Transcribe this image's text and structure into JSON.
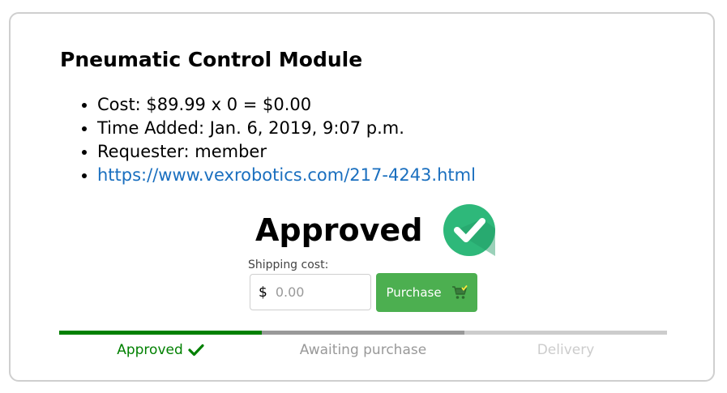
{
  "item": {
    "title": "Pneumatic Control Module",
    "details": [
      "Cost: $89.99 x 0 = $0.00",
      "Time Added: Jan. 6, 2019, 9:07 p.m.",
      "Requester: member"
    ],
    "link": "https://www.vexrobotics.com/217-4243.html"
  },
  "status": {
    "text": "Approved",
    "icon": "check-circle-icon",
    "icon_color": "#2eb87a"
  },
  "shipping": {
    "label": "Shipping cost:",
    "currency": "$",
    "placeholder": "0.00"
  },
  "purchase": {
    "label": "Purchase",
    "icon": "cart-icon",
    "color": "#4caf50"
  },
  "progress": {
    "steps": [
      {
        "label": "Approved",
        "state": "done",
        "color": "#008000",
        "icon": "checkmark-icon"
      },
      {
        "label": "Awaiting purchase",
        "state": "current",
        "color": "#999999"
      },
      {
        "label": "Delivery",
        "state": "pending",
        "color": "#cccccc"
      }
    ]
  }
}
